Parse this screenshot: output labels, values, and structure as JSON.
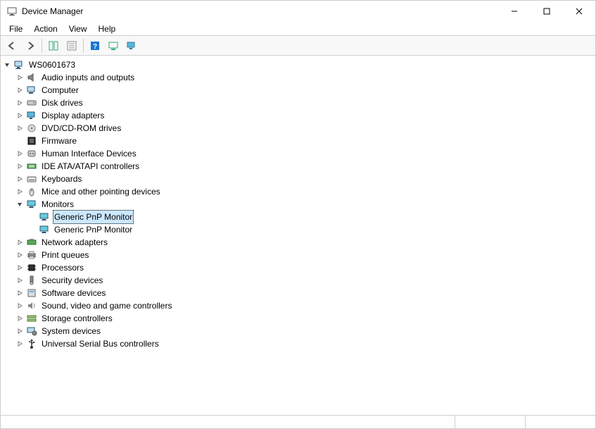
{
  "title": "Device Manager",
  "menu": {
    "file": "File",
    "action": "Action",
    "view": "View",
    "help": "Help"
  },
  "root": {
    "label": "WS0601673",
    "expanded": true,
    "categories": [
      {
        "label": "Audio inputs and outputs",
        "icon": "audio",
        "expanded": false,
        "children": []
      },
      {
        "label": "Computer",
        "icon": "computer",
        "expanded": false,
        "children": []
      },
      {
        "label": "Disk drives",
        "icon": "disk",
        "expanded": false,
        "children": []
      },
      {
        "label": "Display adapters",
        "icon": "display",
        "expanded": false,
        "children": []
      },
      {
        "label": "DVD/CD-ROM drives",
        "icon": "dvd",
        "expanded": false,
        "children": []
      },
      {
        "label": "Firmware",
        "icon": "firmware",
        "noexpand": true
      },
      {
        "label": "Human Interface Devices",
        "icon": "hid",
        "expanded": false
      },
      {
        "label": "IDE ATA/ATAPI controllers",
        "icon": "ide",
        "expanded": false
      },
      {
        "label": "Keyboards",
        "icon": "keyboard",
        "expanded": false
      },
      {
        "label": "Mice and other pointing devices",
        "icon": "mouse",
        "expanded": false
      },
      {
        "label": "Monitors",
        "icon": "monitor",
        "expanded": true,
        "children": [
          {
            "label": "Generic PnP Monitor",
            "icon": "monitor",
            "selected": true
          },
          {
            "label": "Generic PnP Monitor",
            "icon": "monitor"
          }
        ]
      },
      {
        "label": "Network adapters",
        "icon": "network",
        "expanded": false
      },
      {
        "label": "Print queues",
        "icon": "printer",
        "expanded": false
      },
      {
        "label": "Processors",
        "icon": "cpu",
        "expanded": false
      },
      {
        "label": "Security devices",
        "icon": "security",
        "expanded": false
      },
      {
        "label": "Software devices",
        "icon": "software",
        "expanded": false
      },
      {
        "label": "Sound, video and game controllers",
        "icon": "sound",
        "expanded": false
      },
      {
        "label": "Storage controllers",
        "icon": "storage",
        "expanded": false
      },
      {
        "label": "System devices",
        "icon": "system",
        "expanded": false
      },
      {
        "label": "Universal Serial Bus controllers",
        "icon": "usb",
        "expanded": false
      }
    ]
  }
}
